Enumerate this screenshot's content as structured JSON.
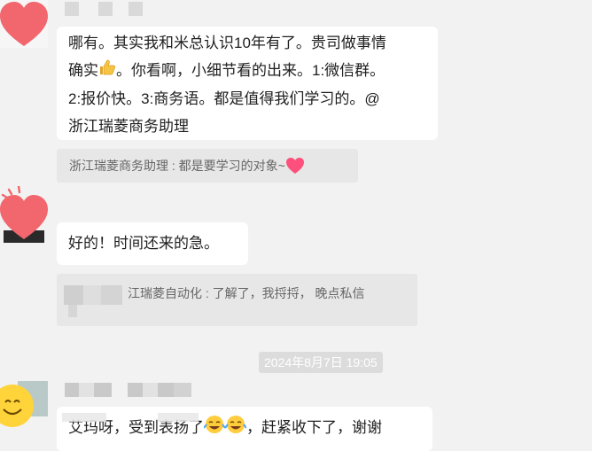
{
  "messages": [
    {
      "lines": [
        "哪有。其实我和米总认识10年有了。贵司做事情",
        "确实",
        "。你看啊，小细节看的出来。1:微信群。",
        "2:报价快。3:商务语。都是值得我们学习的。@",
        "浙江瑞菱商务助理"
      ]
    },
    {
      "quote": "浙江瑞菱商务助理 : 都是要学习的对象~"
    },
    {
      "text": "好的！时间还来的急。"
    },
    {
      "quote": "江瑞菱自动化 : 了解了，我捋捋， 晚点私信"
    },
    {
      "time": "2024年8月7日 19:05"
    },
    {
      "text_a": "艾玛呀，受到表扬了",
      "text_b": "，赶紧收下了，谢谢"
    }
  ],
  "icons": {
    "thumbs": "thumbs-up-icon",
    "heart": "heart-icon",
    "laughing": "laughing-crying-icon"
  }
}
